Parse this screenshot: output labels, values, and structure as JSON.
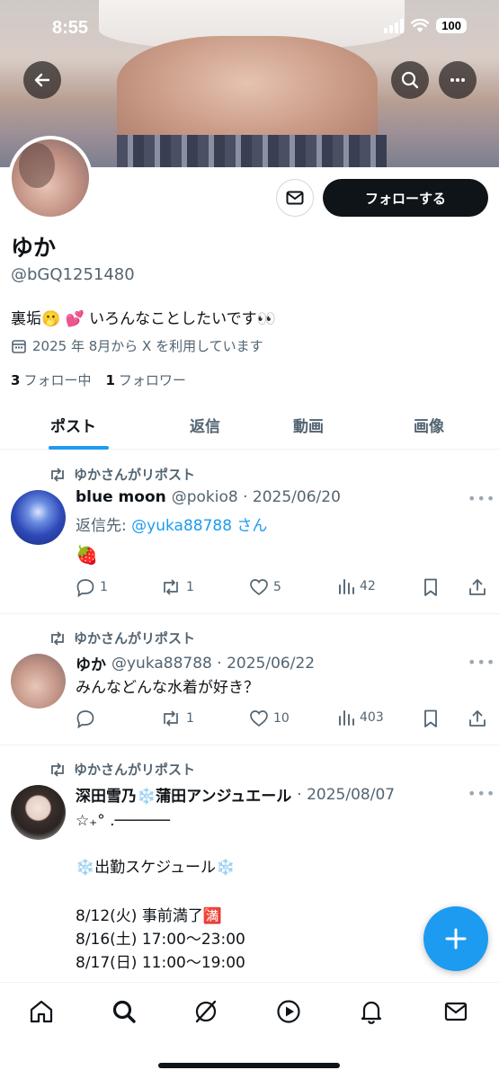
{
  "status_bar": {
    "time": "8:55",
    "battery": "100"
  },
  "profile": {
    "display_name": "ゆか",
    "handle": "@bGQ1251480",
    "bio": "裏垢🫢 💕 いろんなことしたいです👀",
    "joined": "2025 年 8月から X を利用しています",
    "following_count": "3",
    "following_label": "フォロー中",
    "followers_count": "1",
    "followers_label": "フォロワー",
    "follow_button": "フォローする"
  },
  "tabs": [
    {
      "label": "ポスト",
      "active": true
    },
    {
      "label": "返信",
      "active": false
    },
    {
      "label": "動画",
      "active": false
    },
    {
      "label": "画像",
      "active": false
    }
  ],
  "posts": [
    {
      "repost_label": "ゆかさんがリポスト",
      "name": "blue moon",
      "meta": "@pokio8 · 2025/06/20",
      "reply_prefix": "返信先: ",
      "reply_mention": "@yuka88788 さん",
      "text": "🍓",
      "replies": "1",
      "reposts": "1",
      "likes": "5",
      "views": "42"
    },
    {
      "repost_label": "ゆかさんがリポスト",
      "name": "ゆか",
      "meta": "@yuka88788 · 2025/06/22",
      "text": "みんなどんな水着が好き？",
      "replies": "",
      "reposts": "1",
      "likes": "10",
      "views": "403"
    },
    {
      "repost_label": "ゆかさんがリポスト",
      "name": "深田雪乃❄️蒲田アンジュエール",
      "meta": "· 2025/08/07",
      "lines": [
        "☆₊° .──────",
        "",
        "❄️出勤スケジュール❄️",
        "",
        "8/12(火) 事前満了🈵",
        "8/16(土) 17:00～23:00",
        "8/17(日) 11:00～19:00"
      ]
    }
  ],
  "colors": {
    "accent": "#1d9bf0",
    "text": "#0f1419",
    "muted": "#536471"
  },
  "icons": {
    "back": "arrow-left-icon",
    "search": "search-icon",
    "more": "more-horizontal-icon",
    "message": "envelope-icon",
    "calendar": "calendar-icon",
    "repost": "repost-icon",
    "reply": "reply-icon",
    "like": "heart-icon",
    "views": "bar-chart-icon",
    "bookmark": "bookmark-icon",
    "share": "share-icon",
    "compose": "plus-icon",
    "nav": [
      "home-icon",
      "search-icon",
      "grok-icon",
      "play-icon",
      "bell-icon",
      "mail-icon"
    ]
  }
}
